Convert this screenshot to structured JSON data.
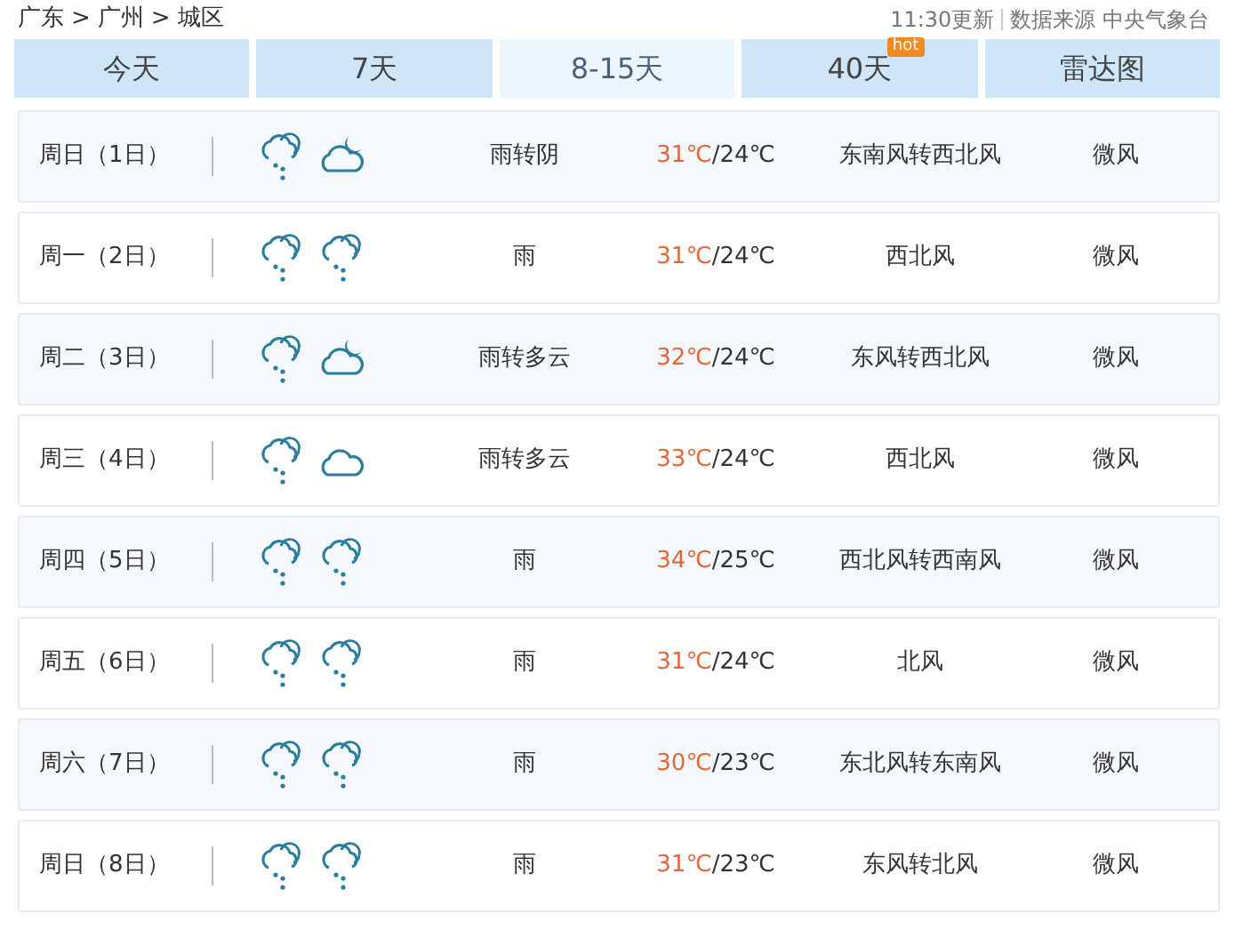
{
  "breadcrumb": [
    "广东",
    ">",
    "广州",
    ">",
    "城区"
  ],
  "update": {
    "time": "11:30更新",
    "source": "数据来源 中央气象台"
  },
  "tabs": [
    {
      "label": "今天",
      "selected": false
    },
    {
      "label": "7天",
      "selected": false
    },
    {
      "label": "8-15天",
      "selected": true
    },
    {
      "label": "40天",
      "selected": false,
      "badge": "hot"
    },
    {
      "label": "雷达图",
      "selected": false
    }
  ],
  "days": [
    {
      "date": "周日（1日）",
      "icons": [
        {
          "kind": "rain"
        },
        {
          "kind": "moon-cloud"
        }
      ],
      "weather": "雨转阴",
      "high": "31℃",
      "low": "/24℃",
      "wind": "东南风转西北风",
      "force": "微风"
    },
    {
      "date": "周一（2日）",
      "icons": [
        {
          "kind": "rain"
        },
        {
          "kind": "rain"
        }
      ],
      "weather": "雨",
      "high": "31℃",
      "low": "/24℃",
      "wind": "西北风",
      "force": "微风"
    },
    {
      "date": "周二（3日）",
      "icons": [
        {
          "kind": "rain"
        },
        {
          "kind": "moon-cloud"
        }
      ],
      "weather": "雨转多云",
      "high": "32℃",
      "low": "/24℃",
      "wind": "东风转西北风",
      "force": "微风"
    },
    {
      "date": "周三（4日）",
      "icons": [
        {
          "kind": "rain"
        },
        {
          "kind": "cloud"
        }
      ],
      "weather": "雨转多云",
      "high": "33℃",
      "low": "/24℃",
      "wind": "西北风",
      "force": "微风"
    },
    {
      "date": "周四（5日）",
      "icons": [
        {
          "kind": "rain"
        },
        {
          "kind": "rain"
        }
      ],
      "weather": "雨",
      "high": "34℃",
      "low": "/25℃",
      "wind": "西北风转西南风",
      "force": "微风"
    },
    {
      "date": "周五（6日）",
      "icons": [
        {
          "kind": "rain"
        },
        {
          "kind": "rain"
        }
      ],
      "weather": "雨",
      "high": "31℃",
      "low": "/24℃",
      "wind": "北风",
      "force": "微风"
    },
    {
      "date": "周六（7日）",
      "icons": [
        {
          "kind": "rain"
        },
        {
          "kind": "rain"
        }
      ],
      "weather": "雨",
      "high": "30℃",
      "low": "/23℃",
      "wind": "东北风转东南风",
      "force": "微风"
    },
    {
      "date": "周日（8日）",
      "icons": [
        {
          "kind": "rain"
        },
        {
          "kind": "rain"
        }
      ],
      "weather": "雨",
      "high": "31℃",
      "low": "/23℃",
      "wind": "东风转北风",
      "force": "微风"
    }
  ]
}
